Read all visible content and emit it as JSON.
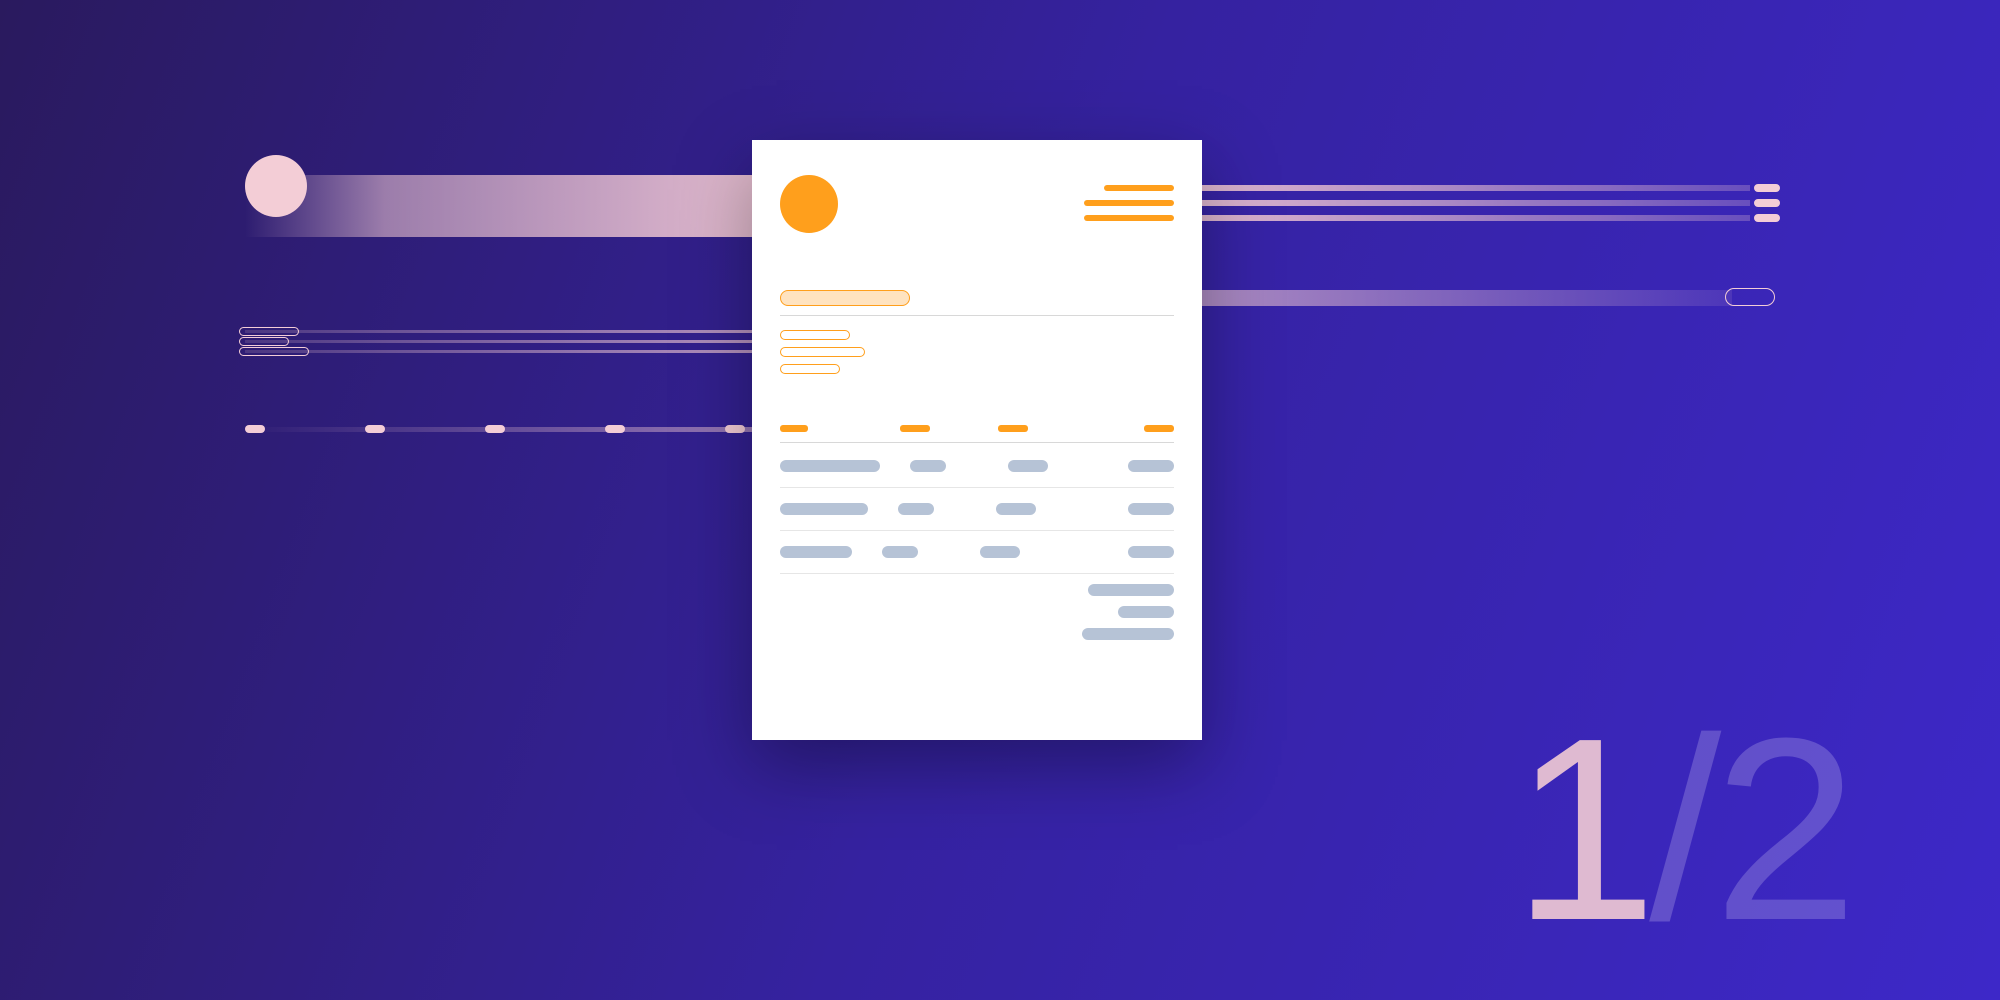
{
  "illustration": {
    "type": "invoice-template-hero",
    "accent_color": "#ff9f1c",
    "placeholder_color": "#b6c3d6",
    "trail_color": "#f3cdd6"
  },
  "pagination": {
    "current": "1",
    "separator": "/",
    "total": "2"
  }
}
